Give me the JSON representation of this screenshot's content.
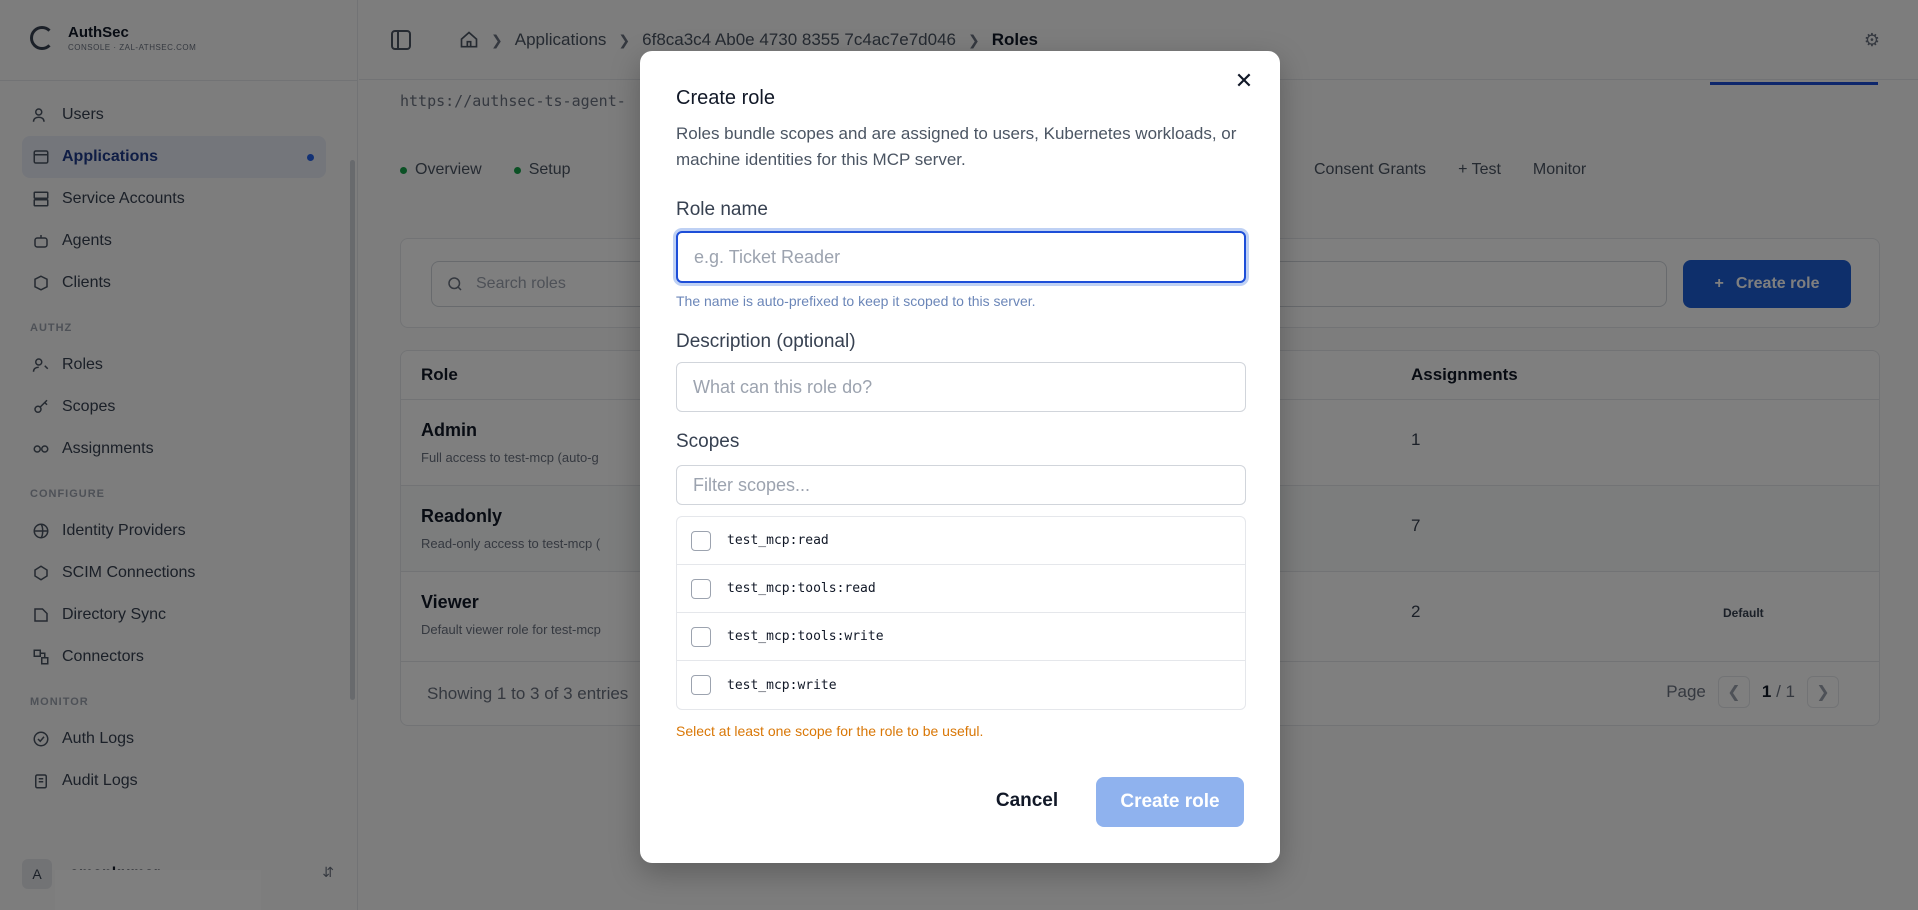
{
  "brand": {
    "name": "AuthSec",
    "subtitle": "CONSOLE · ZAL-ATHSEC.COM"
  },
  "sidebar": {
    "items_top": [
      {
        "label": "Users",
        "icon": "users-icon"
      },
      {
        "label": "Applications",
        "icon": "applications-icon"
      },
      {
        "label": "Service Accounts",
        "icon": "service-accounts-icon"
      },
      {
        "label": "Agents",
        "icon": "agents-icon"
      },
      {
        "label": "Clients",
        "icon": "clients-icon"
      }
    ],
    "section_authz": "AUTHZ",
    "items_authz": [
      {
        "label": "Roles",
        "icon": "roles-icon"
      },
      {
        "label": "Scopes",
        "icon": "key-icon"
      },
      {
        "label": "Assignments",
        "icon": "link-icon"
      }
    ],
    "section_configure": "CONFIGURE",
    "items_configure": [
      {
        "label": "Identity Providers",
        "icon": "globe-icon"
      },
      {
        "label": "SCIM Connections",
        "icon": "scim-icon"
      },
      {
        "label": "Directory Sync",
        "icon": "sync-icon"
      },
      {
        "label": "Connectors",
        "icon": "plug-icon"
      }
    ],
    "section_monitor": "MONITOR",
    "items_monitor": [
      {
        "label": "Auth Logs",
        "icon": "shield-icon"
      },
      {
        "label": "Audit Logs",
        "icon": "clipboard-icon"
      }
    ],
    "user": {
      "initial": "A",
      "name": "amankumar"
    }
  },
  "topbar": {
    "breadcrumbs": [
      "Applications",
      "6f8ca3c4 Ab0e 4730 8355 7c4ac7e7d046",
      "Roles"
    ]
  },
  "page": {
    "url": "https://authsec-ts-agent-",
    "tabs_left": [
      {
        "label": "Overview",
        "dot": true
      },
      {
        "label": "Setup",
        "dot": true
      }
    ],
    "tabs_right": [
      "Consent Grants",
      "+ Test",
      "Monitor"
    ],
    "search_placeholder": "Search roles",
    "create_button": "Create role",
    "table": {
      "headers": {
        "role": "Role",
        "assignments": "Assignments"
      },
      "rows": [
        {
          "name": "Admin",
          "desc": "Full access to test-mcp (auto-g",
          "assignments": "1",
          "badge": ""
        },
        {
          "name": "Readonly",
          "desc": "Read-only access to test-mcp (",
          "assignments": "7",
          "badge": ""
        },
        {
          "name": "Viewer",
          "desc": "Default viewer role for test-mcp",
          "assignments": "2",
          "badge": "Default"
        }
      ],
      "footer": "Showing 1 to 3 of 3 entries",
      "page_label": "Page",
      "page_current": "1",
      "page_total": "/ 1"
    }
  },
  "modal": {
    "title": "Create role",
    "description": "Roles bundle scopes and are assigned to users, Kubernetes workloads, or machine identities for this MCP server.",
    "role_name_label": "Role name",
    "role_name_placeholder": "e.g. Ticket Reader",
    "role_name_value": "",
    "role_name_hint": "The name is auto-prefixed to keep it scoped to this server.",
    "description_label": "Description (optional)",
    "description_placeholder": "What can this role do?",
    "scopes_label": "Scopes",
    "scopes_filter_placeholder": "Filter scopes...",
    "scopes": [
      {
        "name": "test_mcp:read",
        "checked": false
      },
      {
        "name": "test_mcp:tools:read",
        "checked": false
      },
      {
        "name": "test_mcp:tools:write",
        "checked": false
      },
      {
        "name": "test_mcp:write",
        "checked": false
      }
    ],
    "warning": "Select at least one scope for the role to be useful.",
    "cancel_label": "Cancel",
    "submit_label": "Create role"
  },
  "colors": {
    "accent": "#1d5fd6",
    "submit_disabled": "#8fb2ee",
    "warning": "#d97706",
    "focus_ring": "#1d4ed8",
    "status_dot": "#16a34a"
  }
}
